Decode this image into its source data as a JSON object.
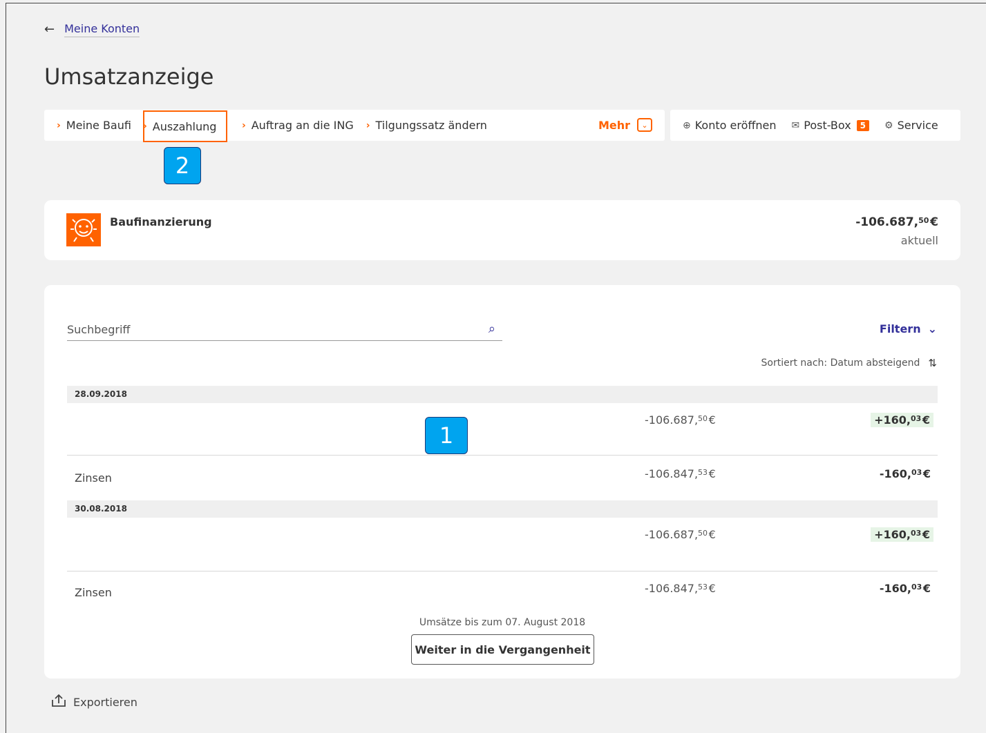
{
  "header": {
    "back_label": "Meine Konten",
    "page_title": "Umsatzanzeige"
  },
  "nav": {
    "items": [
      {
        "label": "Meine Baufi"
      },
      {
        "label": "Auszahlung"
      },
      {
        "label": "Auftrag an die ING"
      },
      {
        "label": "Tilgungssatz ändern"
      }
    ],
    "more_label": "Mehr"
  },
  "toolbar": {
    "open_account": "Konto eröffnen",
    "postbox": "Post-Box",
    "postbox_count": "5",
    "service": "Service"
  },
  "markers": {
    "one": "1",
    "two": "2"
  },
  "account": {
    "name": "Baufinanzierung",
    "amount_main": "-106.687,",
    "amount_cents": "50",
    "currency": "€",
    "status": "aktuell"
  },
  "transactions": {
    "search_placeholder": "Suchbegriff",
    "filter_label": "Filtern",
    "sort_label": "Sortiert nach: Datum absteigend",
    "groups": [
      {
        "date": "28.09.2018",
        "rows": [
          {
            "label": "",
            "saldo_main": "-106.687,",
            "saldo_cents": "50",
            "amount_main": "+160,",
            "amount_cents": "03"
          },
          {
            "label": "Zinsen",
            "saldo_main": "-106.847,",
            "saldo_cents": "53",
            "amount_main": "-160,",
            "amount_cents": "03"
          }
        ]
      },
      {
        "date": "30.08.2018",
        "rows": [
          {
            "label": "",
            "saldo_main": "-106.687,",
            "saldo_cents": "50",
            "amount_main": "+160,",
            "amount_cents": "03"
          },
          {
            "label": "Zinsen",
            "saldo_main": "-106.847,",
            "saldo_cents": "53",
            "amount_main": "-160,",
            "amount_cents": "03"
          }
        ]
      }
    ],
    "currency": "€",
    "more_text": "Umsätze bis zum 07. August 2018",
    "more_button": "Weiter in die Vergangenheit"
  },
  "footer": {
    "export_label": "Exportieren"
  },
  "colors": {
    "accent": "#ff6200",
    "link": "#33309a",
    "marker": "#00a4ef",
    "positive_bg": "#e6f4e6"
  },
  "icons": {
    "back": "arrow-left-icon",
    "search": "search-icon",
    "filter": "chevron-down-icon",
    "sort": "sort-icon",
    "open_account": "plus-circle-icon",
    "postbox": "envelope-icon",
    "service": "gear-icon",
    "export": "upload-icon",
    "logo": "lion-icon"
  }
}
